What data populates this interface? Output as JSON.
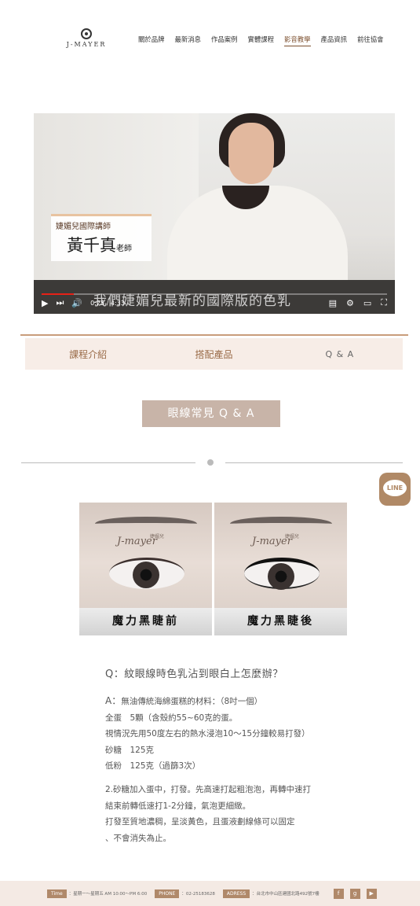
{
  "brand": {
    "logo_text": "J-MAYER"
  },
  "nav": [
    "關於品牌",
    "最新消息",
    "作品案例",
    "實體課程",
    "影音教學",
    "產品資訊",
    "前往協會"
  ],
  "nav_active_index": 4,
  "video": {
    "lower_third_title": "婕媚兒國際講師",
    "lower_third_name": "黃千真",
    "lower_third_suffix": "老師",
    "subtitle": "我們婕媚兒最新的國際版的色乳",
    "time": "0:25 / 4:33",
    "progress": 0.093
  },
  "tabs": [
    "課程介紹",
    "搭配產品",
    "Q & A"
  ],
  "section_button": "眼線常見 Q & A",
  "line_button": "LINE",
  "compare": {
    "watermark": "J-mayer",
    "watermark_sub": "婕媚兒",
    "before_caption": "魔力黑睫前",
    "after_caption": "魔力黑睫後"
  },
  "qa": {
    "question": "Q：紋眼線時色乳沾到眼白上怎麼辦？",
    "answer_label": "A：",
    "answer_lines": [
      "無油傳統海綿蛋糕的材料：（8吋一個）",
      "全蛋　5顆（含殼約55~60克的蛋。",
      "視情況先用50度左右的熱水浸泡10～15分鐘較易打發）",
      "砂糖　125克",
      "低粉　125克（過篩3次）"
    ],
    "step_lines": [
      "2.砂糖加入蛋中，打發。先高速打起粗泡泡，再轉中速打",
      "結束前轉低速打1-2分鐘，氣泡更細緻。",
      "打發至質地濃稠，呈淡黃色，且蛋液劃線條可以固定",
      "、不會消失為止。"
    ]
  },
  "footer": {
    "time_label": "Time",
    "time_value": "：星期一～星期五 AM 10:00～PM 6:00",
    "phone_label": "PHONE",
    "phone_value": "：02-25183628",
    "address_label": "ADRESS",
    "address_value": "：台北市中山區建國北路492號7樓",
    "social": [
      "f",
      "g",
      "▶"
    ]
  }
}
